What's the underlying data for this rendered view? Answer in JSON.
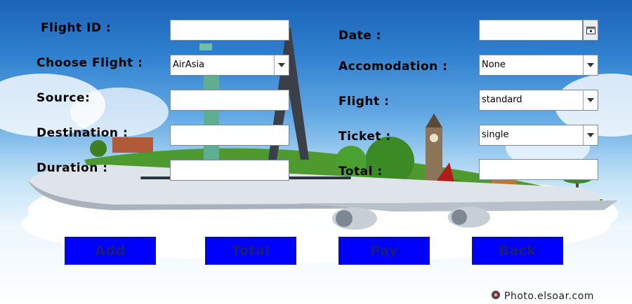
{
  "form": {
    "left": {
      "flight_id_label": "Flight ID :",
      "flight_id_value": "",
      "choose_flight_label": "Choose Flight :",
      "choose_flight_value": "AirAsia",
      "source_label": "Source:",
      "source_value": "",
      "destination_label": "Destination :",
      "destination_value": "",
      "duration_label": "Duration :",
      "duration_value": ""
    },
    "right": {
      "date_label": "Date :",
      "date_value": "",
      "accomodation_label": "Accomodation :",
      "accomodation_value": "None",
      "flight_label": "Flight :",
      "flight_value": "standard",
      "ticket_label": "Ticket :",
      "ticket_value": "single",
      "total_label": "Total :",
      "total_value": ""
    }
  },
  "buttons": {
    "add": "Add",
    "total": "Total",
    "pay": "Pay",
    "back": "Back"
  },
  "watermark": {
    "text": "Photo.elsoar.com"
  },
  "colors": {
    "button_bg": "#0000ff",
    "button_text": "#1b1b7a",
    "sky_top": "#1d63b8"
  },
  "icons": {
    "calendar": "calendar-icon",
    "dropdown": "chevron-down-icon"
  }
}
